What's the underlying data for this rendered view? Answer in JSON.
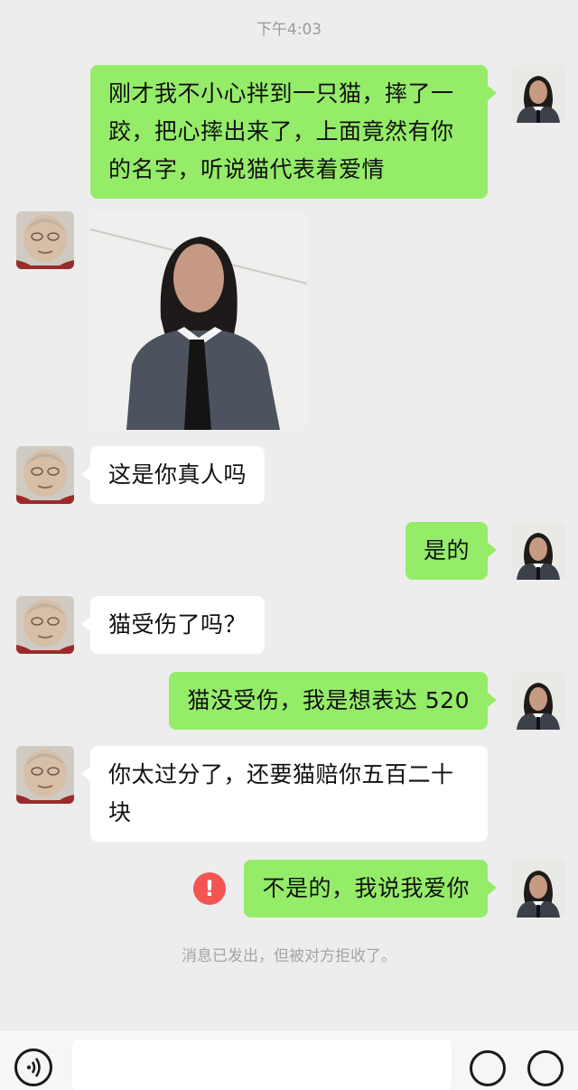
{
  "status": {
    "time": "下午4:03"
  },
  "messages": [
    {
      "from": "me",
      "text": "刚才我不小心拌到一只猫，摔了一跤，把心摔出来了，上面竟然有你的名字，听说猫代表着爱情"
    },
    {
      "from": "them",
      "type": "image"
    },
    {
      "from": "them",
      "text": "这是你真人吗"
    },
    {
      "from": "me",
      "text": "是的"
    },
    {
      "from": "them",
      "text": "猫受伤了吗？"
    },
    {
      "from": "me",
      "text": "猫没受伤，我是想表达 520"
    },
    {
      "from": "them",
      "text": "你太过分了，还要猫赔你五百二十块"
    },
    {
      "from": "me",
      "text": "不是的，我说我爱你",
      "status": "rejected"
    }
  ],
  "error_icon": "!",
  "system_note": "消息已发出，但被对方拒收了。",
  "input": {
    "placeholder": ""
  },
  "colors": {
    "background": "#ededed",
    "my_bubble": "#95ec69",
    "their_bubble": "#ffffff",
    "error": "#f45553",
    "meta_text": "#9a9a9a"
  },
  "icons": {
    "voice": "voice-icon",
    "error": "exclamation-icon",
    "emoji": "emoji-icon",
    "plus": "plus-icon"
  }
}
